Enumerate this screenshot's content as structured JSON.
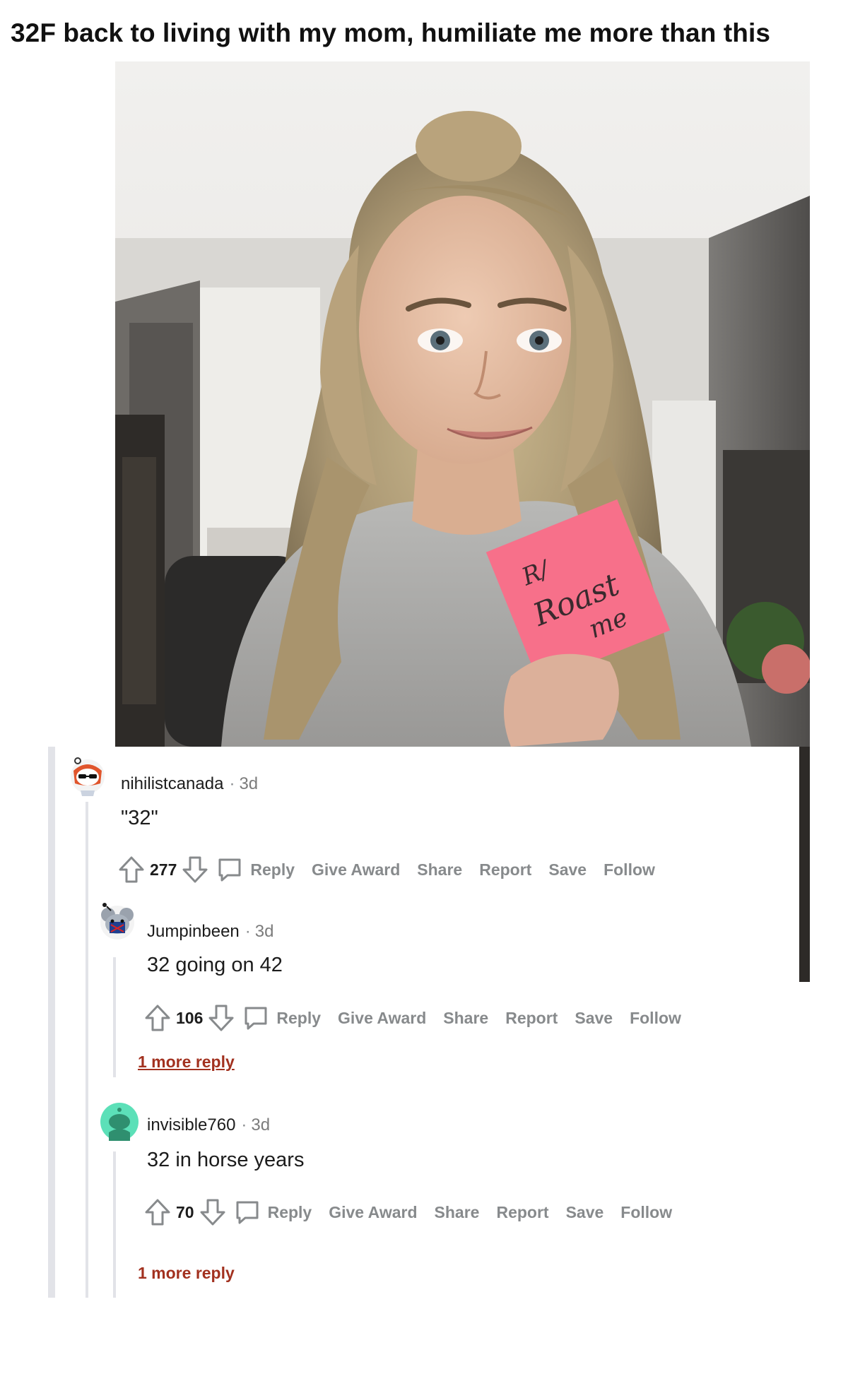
{
  "post": {
    "title": "32F back to living with my mom, humiliate me more than this",
    "image_note_text": "R/ Roast me"
  },
  "comments": [
    {
      "username": "nihilistcanada",
      "age": "3d",
      "body": "\"32\"",
      "score": "277",
      "actions": {
        "reply": "Reply",
        "award": "Give Award",
        "share": "Share",
        "report": "Report",
        "save": "Save",
        "follow": "Follow"
      }
    },
    {
      "username": "Jumpinbeen",
      "age": "3d",
      "body": "32 going on 42",
      "score": "106",
      "actions": {
        "reply": "Reply",
        "award": "Give Award",
        "share": "Share",
        "report": "Report",
        "save": "Save",
        "follow": "Follow"
      },
      "more_replies": "1 more reply"
    },
    {
      "username": "invisible760",
      "age": "3d",
      "body": "32 in horse years",
      "score": "70",
      "actions": {
        "reply": "Reply",
        "award": "Give Award",
        "share": "Share",
        "report": "Report",
        "save": "Save",
        "follow": "Follow"
      },
      "more_replies": "1 more reply"
    }
  ],
  "colors": {
    "action_gray": "#878a8c",
    "more_reply_red": "#a2311f",
    "thread_line": "#e2e3e8",
    "note_pink": "#f7708a"
  },
  "icons": [
    "upvote-icon",
    "downvote-icon",
    "comment-bubble-icon",
    "snoo-avatar-icon"
  ]
}
